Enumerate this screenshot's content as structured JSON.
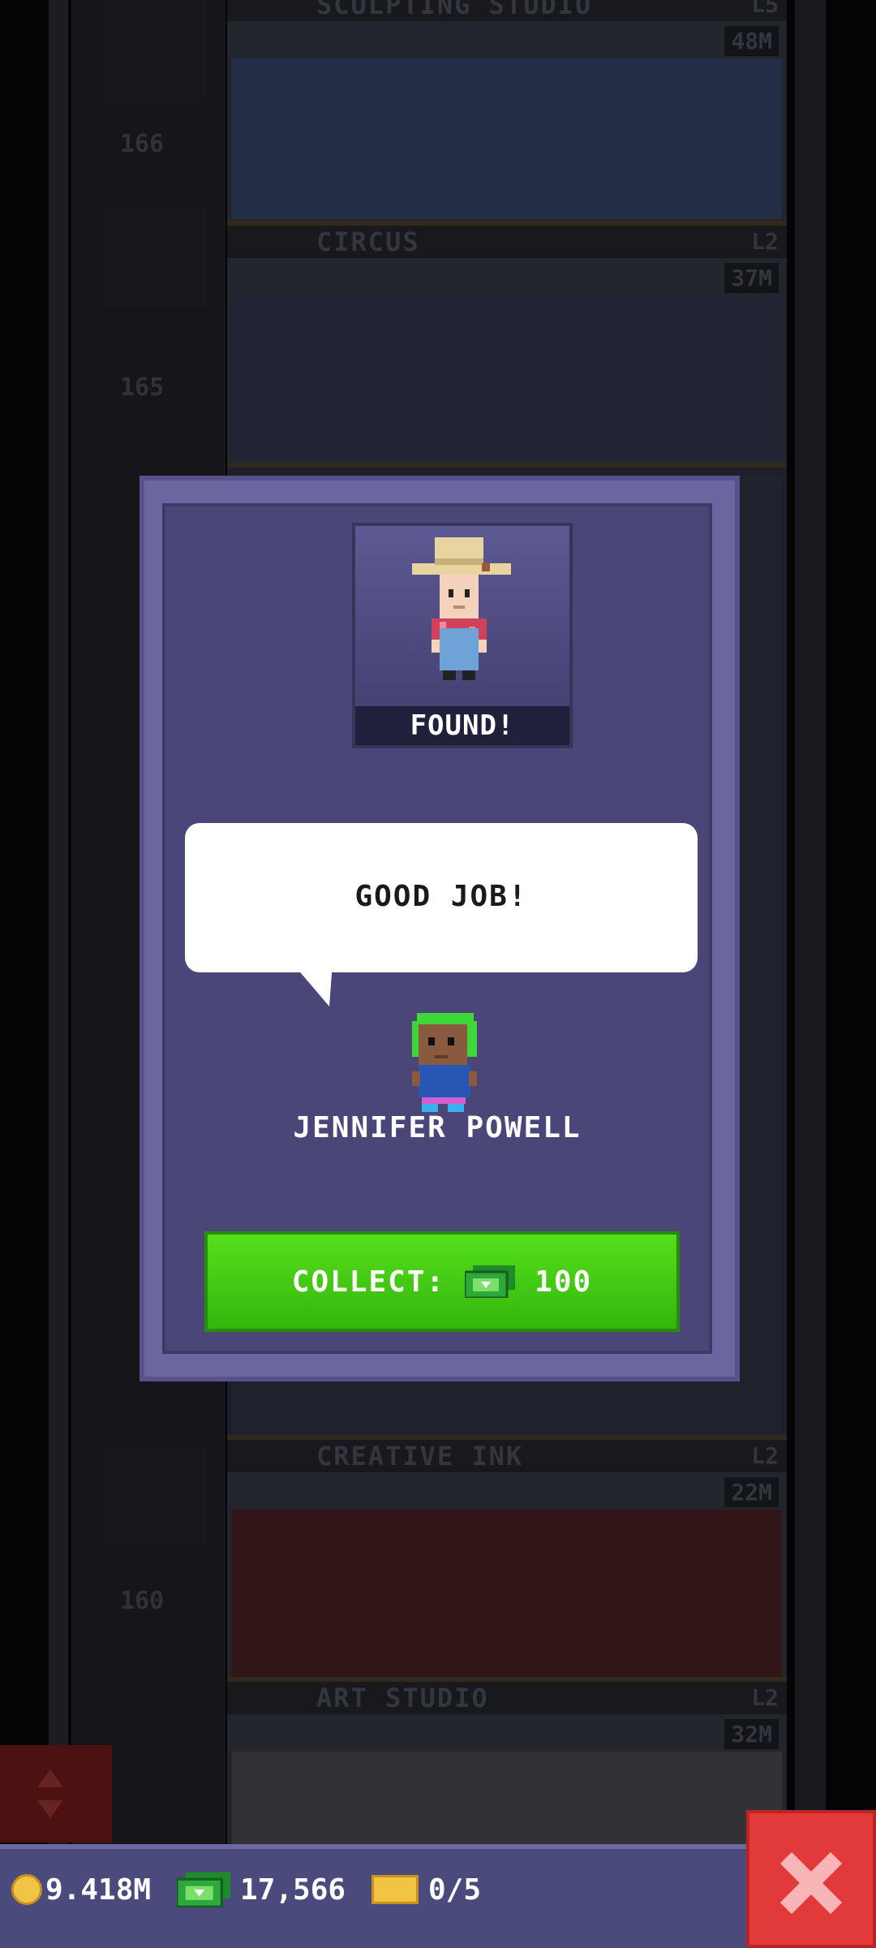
{
  "floors": [
    {
      "name": "SCULPTING STUDIO",
      "level": "L5",
      "price": "48M"
    },
    {
      "name": "CIRCUS",
      "level": "L2",
      "price": "37M"
    },
    {
      "name": "CREATIVE INK",
      "level": "L2",
      "price": "22M"
    },
    {
      "name": "ART STUDIO",
      "level": "L2",
      "price": "32M"
    }
  ],
  "floor_numbers": [
    "166",
    "165",
    "160"
  ],
  "modal": {
    "status_label": "FOUND!",
    "speech": "GOOD JOB!",
    "npc_name": "JENNIFER POWELL",
    "collect_label": "COLLECT:",
    "collect_amount": "100"
  },
  "hud": {
    "coins": "9.418M",
    "bux": "17,566",
    "tickets": "0/5"
  },
  "colors": {
    "modal_bg": "#4a4677",
    "collect_green": "#43c814",
    "close_red": "#e23a3a",
    "bar_bg": "#4b4a7c"
  },
  "icons": [
    "coin-icon",
    "bux-icon",
    "ticket-icon",
    "close-icon",
    "elevator-arrows-icon",
    "check-icon",
    "clock-icon"
  ]
}
